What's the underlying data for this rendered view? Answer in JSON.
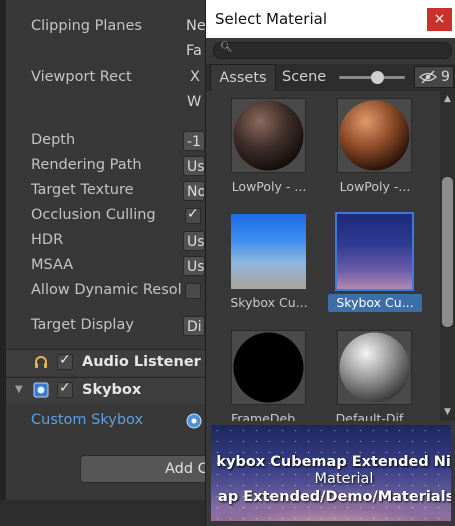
{
  "inspector": {
    "clipping_planes": {
      "label": "Clipping Planes",
      "near": "Ne",
      "far": "Fa"
    },
    "viewport_rect": {
      "label": "Viewport Rect",
      "x": "X",
      "w": "W"
    },
    "depth": {
      "label": "Depth",
      "value": "-1"
    },
    "rendering_path": {
      "label": "Rendering Path",
      "value": "Us"
    },
    "target_texture": {
      "label": "Target Texture",
      "value": "No"
    },
    "occlusion_culling": {
      "label": "Occlusion Culling"
    },
    "hdr": {
      "label": "HDR",
      "value": "Us"
    },
    "msaa": {
      "label": "MSAA",
      "value": "Us"
    },
    "allow_dynamic_resolution": {
      "label": "Allow Dynamic Resol"
    },
    "target_display": {
      "label": "Target Display",
      "value": "Di"
    },
    "audio_listener": {
      "title": "Audio Listener"
    },
    "skybox": {
      "title": "Skybox",
      "custom_skybox_label": "Custom Skybox"
    },
    "add_component": "Add C"
  },
  "select_material": {
    "title": "Select Material",
    "close": "×",
    "tabs": [
      "Assets",
      "Scene"
    ],
    "hidden_count": "9",
    "items": [
      {
        "label": "LowPoly - ..."
      },
      {
        "label": "LowPoly -..."
      },
      {
        "label": "Skybox Cu..."
      },
      {
        "label": "Skybox Cu..."
      },
      {
        "label": "FrameDeb..."
      },
      {
        "label": "Default-Dif..."
      }
    ],
    "preview": {
      "line1": "kybox Cubemap Extended Nigh",
      "line2": "Material",
      "line3": "ap Extended/Demo/Materials/S"
    }
  }
}
